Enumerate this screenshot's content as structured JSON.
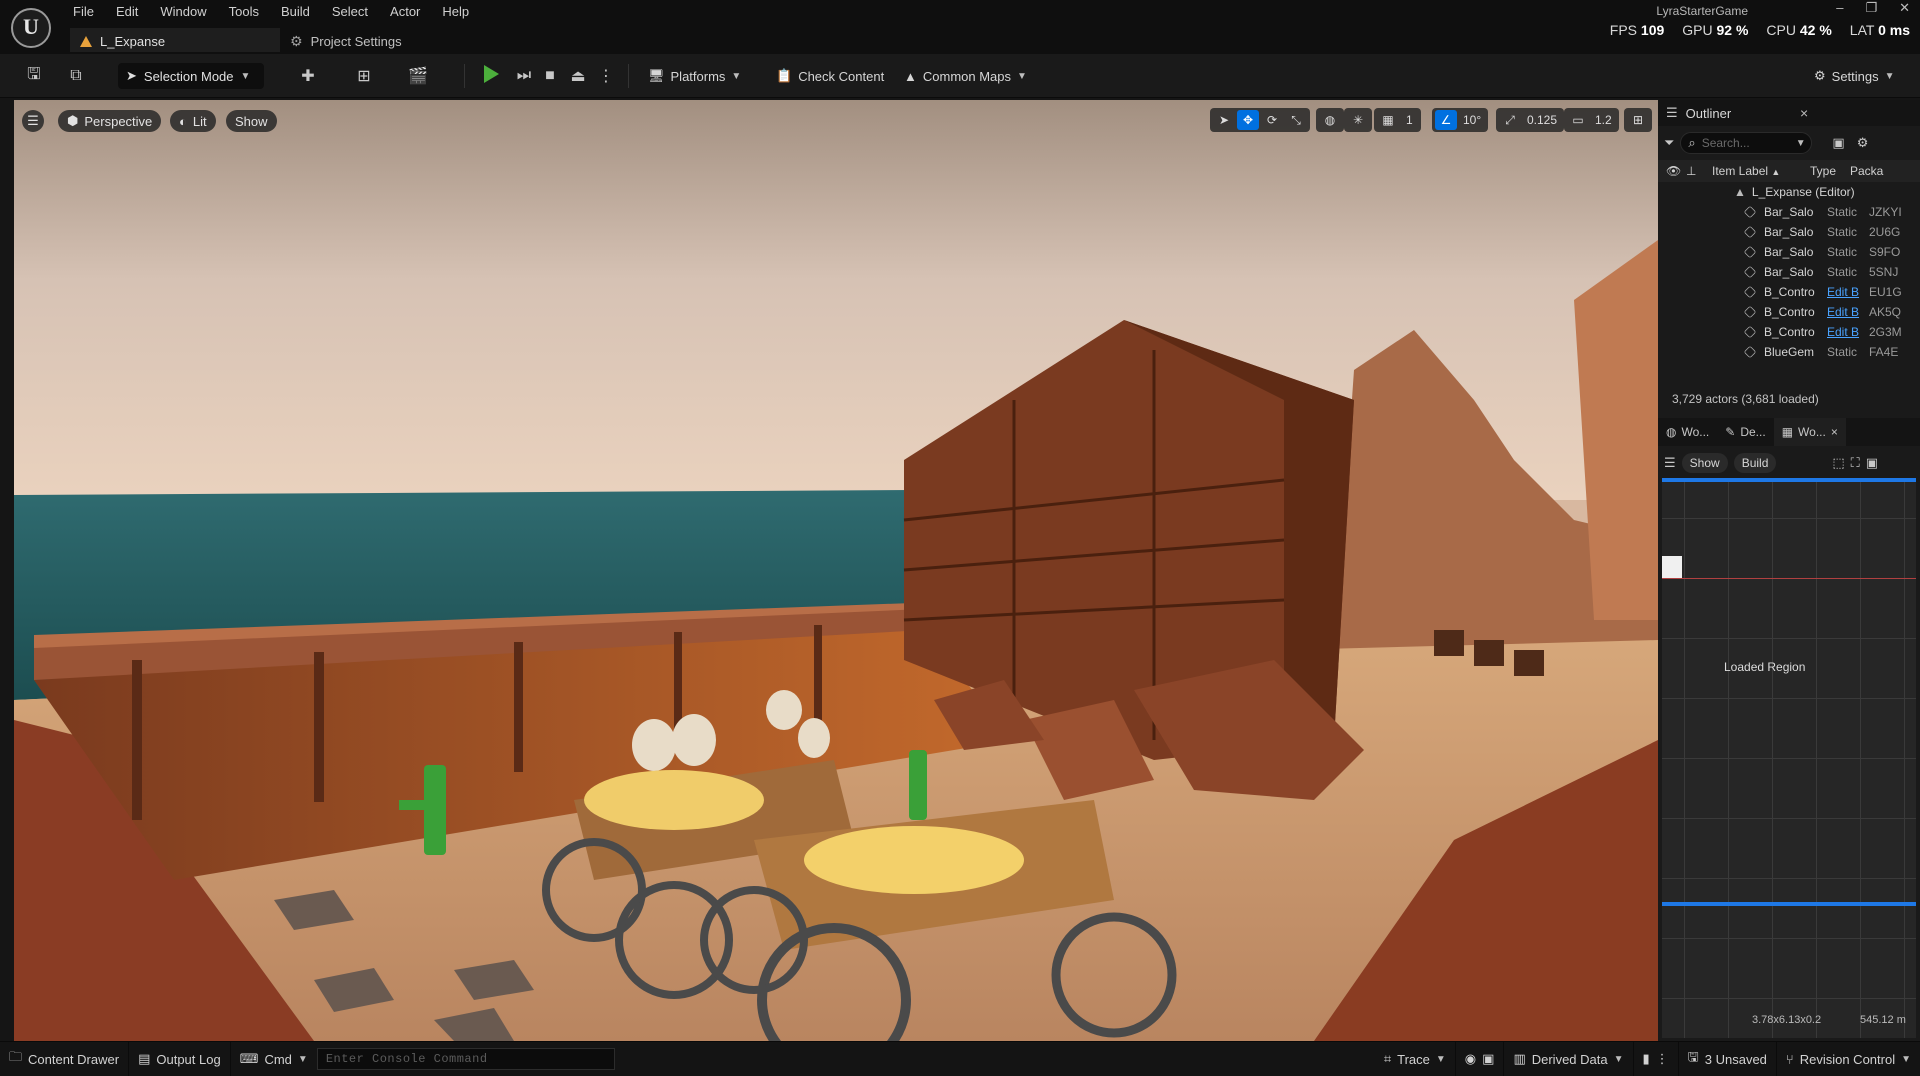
{
  "app": {
    "project_name": "LyraStarterGame",
    "menu": [
      "File",
      "Edit",
      "Window",
      "Tools",
      "Build",
      "Select",
      "Actor",
      "Help"
    ],
    "level_tab": "L_Expanse",
    "project_settings_tab": "Project Settings",
    "stats": {
      "fps_label": "FPS",
      "fps_value": "109",
      "gpu_label": "GPU",
      "gpu_value": "92 %",
      "cpu_label": "CPU",
      "cpu_value": "42 %",
      "lat_label": "LAT",
      "lat_value": "0 ms"
    }
  },
  "toolbar": {
    "selection_mode": "Selection Mode",
    "platforms": "Platforms",
    "check_content": "Check Content",
    "common_maps": "Common Maps",
    "settings": "Settings"
  },
  "viewport": {
    "perspective": "Perspective",
    "lit": "Lit",
    "show": "Show",
    "grid_snap": "1",
    "rotation_snap": "10°",
    "scale_snap": "0.125",
    "camera_speed": "1.2"
  },
  "outliner": {
    "title": "Outliner",
    "search_placeholder": "Search...",
    "columns": {
      "label": "Item Label",
      "sort_arrow": "▲",
      "type": "Type",
      "package": "Packa"
    },
    "root": "L_Expanse (Editor)",
    "rows": [
      {
        "label": "Bar_Salo",
        "type": "Static",
        "pkg": "JZKYI",
        "link": false
      },
      {
        "label": "Bar_Salo",
        "type": "Static",
        "pkg": "2U6G",
        "link": false
      },
      {
        "label": "Bar_Salo",
        "type": "Static",
        "pkg": "S9FO",
        "link": false
      },
      {
        "label": "Bar_Salo",
        "type": "Static",
        "pkg": "5SNJ",
        "link": false
      },
      {
        "label": "B_Contro",
        "type": "Edit B",
        "pkg": "EU1G",
        "link": true
      },
      {
        "label": "B_Contro",
        "type": "Edit B",
        "pkg": "AK5Q",
        "link": true
      },
      {
        "label": "B_Contro",
        "type": "Edit B",
        "pkg": "2G3M",
        "link": true
      },
      {
        "label": "BlueGem",
        "type": "Static",
        "pkg": "FA4E",
        "link": false
      }
    ],
    "actor_count": "3,729 actors (3,681 loaded)"
  },
  "world_partition": {
    "tabs": [
      "Wo...",
      "De...",
      "Wo..."
    ],
    "show": "Show",
    "build": "Build",
    "loaded_region": "Loaded Region",
    "coords": "3.78x6.13x0.2",
    "distance": "545.12 m"
  },
  "statusbar": {
    "content_drawer": "Content Drawer",
    "output_log": "Output Log",
    "cmd": "Cmd",
    "console_placeholder": "Enter Console Command",
    "trace": "Trace",
    "derived_data": "Derived Data",
    "unsaved": "3 Unsaved",
    "revision_control": "Revision Control"
  },
  "colors": {
    "accent": "#0070e0",
    "play": "#4caf3c",
    "level_icon": "#e8a23c",
    "link": "#4aa3ff"
  }
}
